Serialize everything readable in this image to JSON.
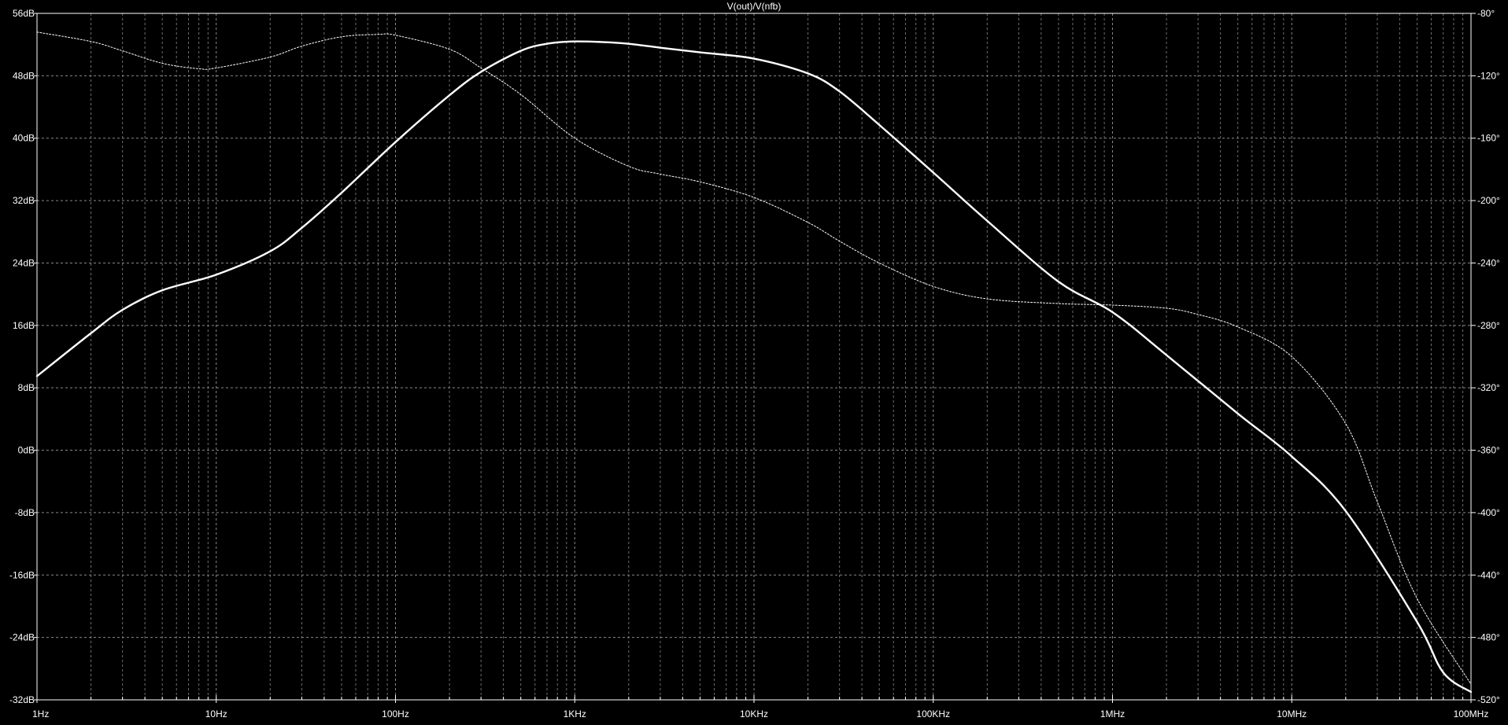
{
  "chart_data": {
    "type": "line",
    "title": "V(out)/V(nfb)",
    "xscale": "log",
    "xlim": [
      1,
      100000000
    ],
    "ylim_left": [
      -32,
      56
    ],
    "ylim_right": [
      -520,
      -80
    ],
    "grid": true,
    "x_ticks": [
      {
        "value": 1,
        "label": "1Hz"
      },
      {
        "value": 10,
        "label": "10Hz"
      },
      {
        "value": 100,
        "label": "100Hz"
      },
      {
        "value": 1000,
        "label": "1KHz"
      },
      {
        "value": 10000,
        "label": "10KHz"
      },
      {
        "value": 100000,
        "label": "100KHz"
      },
      {
        "value": 1000000,
        "label": "1MHz"
      },
      {
        "value": 10000000,
        "label": "10MHz"
      },
      {
        "value": 100000000,
        "label": "100MHz"
      }
    ],
    "y_ticks_left": [
      {
        "value": 56,
        "label": "56dB"
      },
      {
        "value": 48,
        "label": "48dB"
      },
      {
        "value": 40,
        "label": "40dB"
      },
      {
        "value": 32,
        "label": "32dB"
      },
      {
        "value": 24,
        "label": "24dB"
      },
      {
        "value": 16,
        "label": "16dB"
      },
      {
        "value": 8,
        "label": "8dB"
      },
      {
        "value": 0,
        "label": "0dB"
      },
      {
        "value": -8,
        "label": "-8dB"
      },
      {
        "value": -16,
        "label": "-16dB"
      },
      {
        "value": -24,
        "label": "-24dB"
      },
      {
        "value": -32,
        "label": "-32dB"
      }
    ],
    "y_ticks_right": [
      {
        "value": -80,
        "label": "-80°"
      },
      {
        "value": -120,
        "label": "-120°"
      },
      {
        "value": -160,
        "label": "-160°"
      },
      {
        "value": -200,
        "label": "-200°"
      },
      {
        "value": -240,
        "label": "-240°"
      },
      {
        "value": -280,
        "label": "-280°"
      },
      {
        "value": -320,
        "label": "-320°"
      },
      {
        "value": -360,
        "label": "-360°"
      },
      {
        "value": -400,
        "label": "-400°"
      },
      {
        "value": -440,
        "label": "-440°"
      },
      {
        "value": -480,
        "label": "-480°"
      },
      {
        "value": -520,
        "label": "-520°"
      }
    ],
    "series": [
      {
        "axis": "left",
        "style": "solid",
        "x": [
          1,
          2,
          3,
          5,
          10,
          20,
          30,
          50,
          100,
          200,
          300,
          500,
          700,
          1000,
          1500,
          2000,
          3000,
          5000,
          10000,
          20000,
          30000,
          50000,
          100000,
          200000,
          500000,
          1000000,
          2000000,
          5000000,
          10000000,
          20000000,
          50000000,
          70000000,
          100000000
        ],
        "y": [
          9.5,
          15,
          18,
          20.5,
          22.5,
          25.5,
          28.5,
          33,
          39.5,
          45.5,
          48.5,
          51.2,
          52.1,
          52.4,
          52.3,
          52.1,
          51.6,
          51,
          50.2,
          48.3,
          46,
          41.7,
          35.6,
          29.4,
          21.6,
          17.7,
          12.2,
          4.7,
          -0.8,
          -7.8,
          -22,
          -28.5,
          -31
        ]
      },
      {
        "axis": "right",
        "style": "dotted",
        "x": [
          1,
          2,
          3,
          5,
          8,
          10,
          20,
          30,
          50,
          80,
          100,
          200,
          300,
          500,
          1000,
          2000,
          3000,
          5000,
          10000,
          20000,
          30000,
          50000,
          100000,
          200000,
          500000,
          1000000,
          2000000,
          3000000,
          5000000,
          10000000,
          20000000,
          30000000,
          50000000,
          100000000
        ],
        "y": [
          -92,
          -98,
          -104,
          -112,
          -115.5,
          -115,
          -108,
          -101,
          -95,
          -93.5,
          -94,
          -103,
          -115,
          -132,
          -160,
          -178,
          -183,
          -188,
          -198,
          -214,
          -226,
          -240,
          -255,
          -263,
          -266,
          -267,
          -269,
          -273,
          -281,
          -300,
          -343,
          -393,
          -455,
          -510
        ]
      }
    ]
  }
}
